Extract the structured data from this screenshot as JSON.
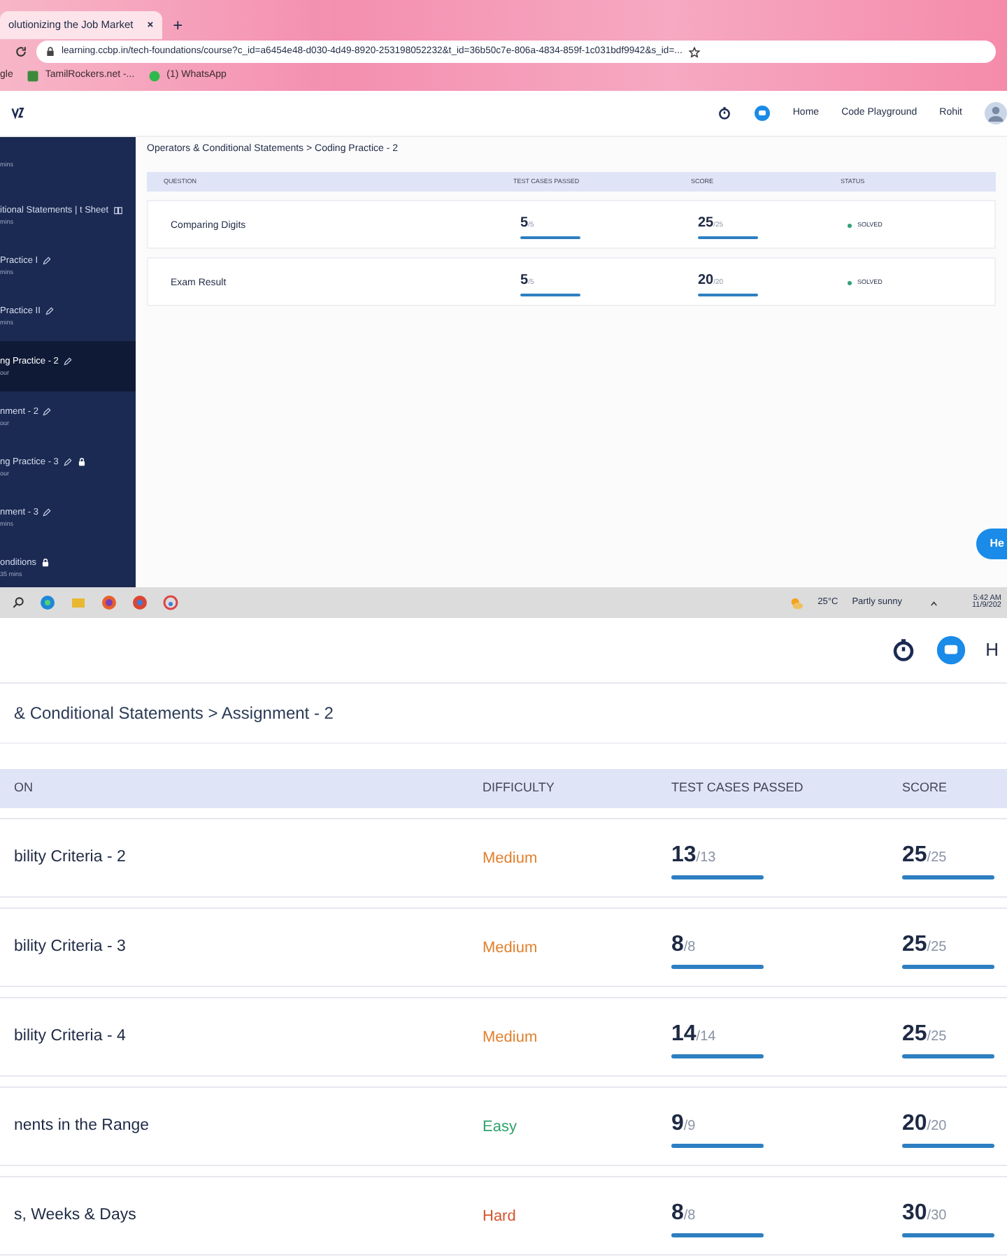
{
  "top_screen": {
    "browser": {
      "tab_title": "olutionizing the Job Market",
      "tab_close": "×",
      "new_tab": "+",
      "url": "learning.ccbp.in/tech-foundations/course?c_id=a6454e48-d030-4d49-8920-253198052232&t_id=36b50c7e-806a-4834-859f-1c031bdf9942&s_id=...",
      "bookmarks": [
        {
          "label": "gle",
          "kind": "plain"
        },
        {
          "label": "TamilRockers.net -...",
          "kind": "site"
        },
        {
          "label": "(1) WhatsApp",
          "kind": "chat"
        }
      ]
    },
    "header": {
      "nav": [
        "Home",
        "Code Playground",
        "Rohit"
      ]
    },
    "sidebar": {
      "items": [
        {
          "subtitle": "mins",
          "notes": false,
          "editable": false,
          "locked": false,
          "selected": false
        },
        {
          "title": "itional Statements | t Sheet",
          "subtitle": "mins",
          "notes": true,
          "editable": false,
          "locked": false,
          "selected": false
        },
        {
          "title": "Practice I",
          "subtitle": "mins",
          "notes": false,
          "editable": true,
          "locked": false,
          "selected": false
        },
        {
          "title": "Practice II",
          "subtitle": "mins",
          "notes": false,
          "editable": true,
          "locked": false,
          "selected": false
        },
        {
          "title": "ng Practice - 2",
          "subtitle": "our",
          "notes": false,
          "editable": true,
          "locked": false,
          "selected": true
        },
        {
          "title": "nment - 2",
          "subtitle": "our",
          "notes": false,
          "editable": true,
          "locked": false,
          "selected": false
        },
        {
          "title": "ng Practice - 3",
          "subtitle": "our",
          "notes": false,
          "editable": true,
          "locked": true,
          "selected": false
        },
        {
          "title": "nment - 3",
          "subtitle": "mins",
          "notes": false,
          "editable": true,
          "locked": false,
          "selected": false
        },
        {
          "title": "onditions",
          "subtitle": "35 mins",
          "notes": false,
          "editable": false,
          "locked": true,
          "selected": false
        }
      ]
    },
    "breadcrumb": "Operators & Conditional Statements > Coding Practice - 2",
    "table": {
      "columns": [
        "QUESTION",
        "TEST CASES PASSED",
        "SCORE",
        "STATUS"
      ],
      "rows": [
        {
          "question": "Comparing Digits",
          "passed": "5",
          "total": "/5",
          "passed_bar": {
            "level": 1
          },
          "score": "25",
          "max": "/25",
          "score_bar": {
            "level": 1
          },
          "status": "SOLVED",
          "color": "#2fa37a"
        },
        {
          "question": "Exam Result",
          "passed": "5",
          "total": "/5",
          "passed_bar": {
            "level": 1
          },
          "score": "20",
          "max": "/20",
          "score_bar": {
            "level": 1
          },
          "status": "SOLVED",
          "color": "#2fa37a"
        }
      ]
    },
    "help_button": "He",
    "taskbar": {
      "weather": "25°C",
      "forecast": "Partly sunny",
      "time": "5:42 AM",
      "date": "11/9/202"
    }
  },
  "bottom_screen": {
    "header": {
      "nav": "H"
    },
    "breadcrumb": "& Conditional Statements > Assignment - 2",
    "table": {
      "columns": [
        "ON",
        "DIFFICULTY",
        "TEST CASES PASSED",
        "SCORE"
      ],
      "rows": [
        {
          "question": "bility Criteria - 2",
          "difficulty": "Medium",
          "color": "#e0812f",
          "passed": "13",
          "total": "/13",
          "passed_bar": {
            "level": 1
          },
          "score": "25",
          "max": "/25",
          "score_bar": {
            "level": 1
          }
        },
        {
          "question": "bility Criteria - 3",
          "difficulty": "Medium",
          "color": "#e0812f",
          "passed": "8",
          "total": "/8",
          "passed_bar": {
            "level": 1
          },
          "score": "25",
          "max": "/25",
          "score_bar": {
            "level": 1
          }
        },
        {
          "question": "bility Criteria - 4",
          "difficulty": "Medium",
          "color": "#e0812f",
          "passed": "14",
          "total": "/14",
          "passed_bar": {
            "level": 1
          },
          "score": "25",
          "max": "/25",
          "score_bar": {
            "level": 1
          }
        },
        {
          "question": "nents in the Range",
          "difficulty": "Easy",
          "color": "#2fa36b",
          "passed": "9",
          "total": "/9",
          "passed_bar": {
            "level": 1
          },
          "score": "20",
          "max": "/20",
          "score_bar": {
            "level": 1
          }
        },
        {
          "question": "s, Weeks & Days",
          "difficulty": "Hard",
          "color": "#d4542c",
          "passed": "8",
          "total": "/8",
          "passed_bar": {
            "level": 1
          },
          "score": "30",
          "max": "/30",
          "score_bar": {
            "level": 1
          }
        }
      ]
    }
  }
}
